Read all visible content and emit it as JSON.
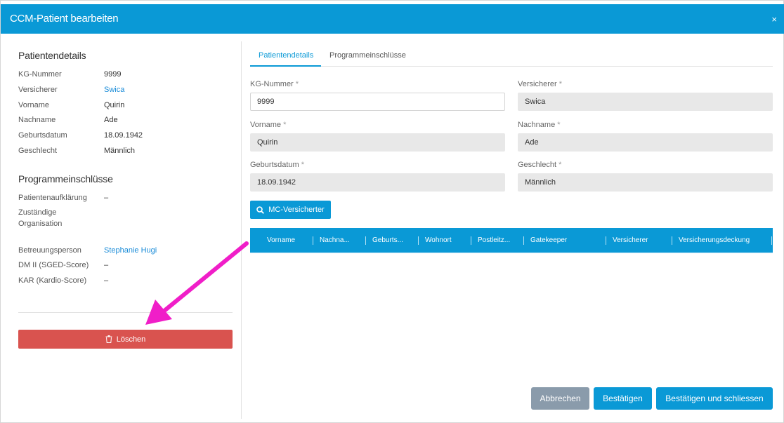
{
  "modal": {
    "title": "CCM-Patient bearbeiten",
    "close_label": "×"
  },
  "left": {
    "patient_section_title": "Patientendetails",
    "patient_details": [
      {
        "label": "KG-Nummer",
        "value": "9999"
      },
      {
        "label": "Versicherer",
        "value": "Swica"
      },
      {
        "label": "Vorname",
        "value": "Quirin"
      },
      {
        "label": "Nachname",
        "value": "Ade"
      },
      {
        "label": "Geburtsdatum",
        "value": "18.09.1942"
      },
      {
        "label": "Geschlecht",
        "value": "Männlich"
      }
    ],
    "program_section_title": "Programmeinschlüsse",
    "program_details": [
      {
        "label": "Patientenaufklärung",
        "value": "–"
      },
      {
        "label": "Zuständige",
        "label2": "Organisation",
        "value": ""
      },
      {
        "label": "Betreuungsperson",
        "value": "Stephanie Hugi"
      },
      {
        "label": "DM II (SGED-Score)",
        "value": "–"
      },
      {
        "label": "KAR (Kardio-Score)",
        "value": "–"
      }
    ],
    "delete_label": "Löschen"
  },
  "tabs": [
    {
      "label": "Patientendetails"
    },
    {
      "label": "Programmeinschlüsse"
    }
  ],
  "form": {
    "required_marker": "*",
    "kg_nummer": {
      "label": "KG-Nummer",
      "value": "9999"
    },
    "versicherer": {
      "label": "Versicherer",
      "value": "Swica"
    },
    "vorname": {
      "label": "Vorname",
      "value": "Quirin"
    },
    "nachname": {
      "label": "Nachname",
      "value": "Ade"
    },
    "geburtsdatum": {
      "label": "Geburtsdatum",
      "value": "18.09.1942"
    },
    "geschlecht": {
      "label": "Geschlecht",
      "value": "Männlich"
    }
  },
  "mc_button_label": "MC-Versicherter",
  "grid": {
    "columns": [
      "Vorname",
      "Nachna...",
      "Geburts...",
      "Wohnort",
      "Postleitz...",
      "Gatekeeper",
      "Versicherer",
      "Versicherungsdeckung"
    ]
  },
  "footer": {
    "cancel_label": "Abbrechen",
    "confirm_label": "Bestätigen",
    "confirm_close_label": "Bestätigen und schliessen"
  },
  "colors": {
    "primary": "#0a99d6",
    "danger": "#d9534f",
    "secondary": "#8a9bab",
    "annotation_arrow": "#f01ec8"
  }
}
